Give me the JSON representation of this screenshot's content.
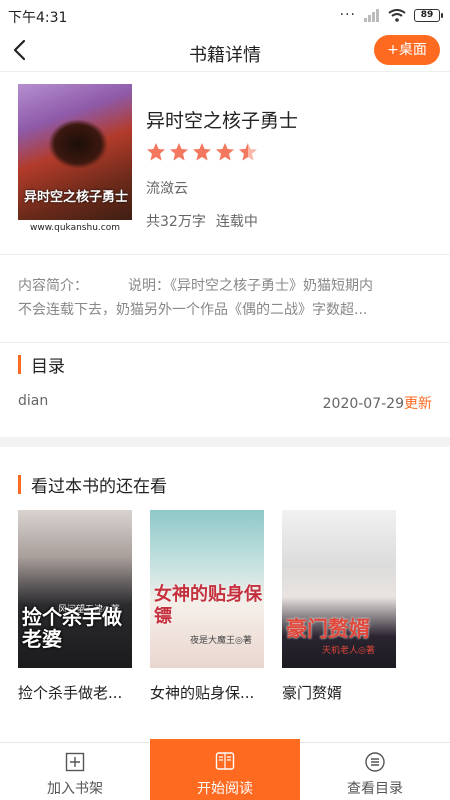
{
  "status": {
    "time": "下午4:31",
    "battery": "89"
  },
  "header": {
    "title": "书籍详情",
    "desk_button": "+桌面"
  },
  "book": {
    "title": "异时空之核子勇士",
    "rating": 4.5,
    "author": "流潋云",
    "word_count": "共32万字",
    "status": "连载中",
    "cover_title": "异时空之核子勇士",
    "cover_site": "www.qukanshu.com"
  },
  "intro": {
    "label": "内容简介：",
    "line1": "说明：《异时空之核子勇士》奶猫短期内",
    "line2": "不会连载下去，奶猫另外一个作品《偶的二战》字数超..."
  },
  "toc": {
    "heading": "目录",
    "latest_chapter": "dian",
    "date": "2020-07-29",
    "update_label": "更新"
  },
  "recommend": {
    "heading": "看过本书的还在看",
    "items": [
      {
        "name": "捡个杀手做老...",
        "cover_text": "捡个杀手做老婆",
        "cover_author": "风间望五津◎著"
      },
      {
        "name": "女神的贴身保...",
        "cover_text": "女神的贴身保镖",
        "cover_author": "夜是大魔王◎著"
      },
      {
        "name": "豪门赘婿",
        "cover_text": "豪门赘婿",
        "cover_author": "天机老人◎著"
      }
    ]
  },
  "bottom": {
    "add_shelf": "加入书架",
    "start_read": "开始阅读",
    "view_toc": "查看目录"
  },
  "colors": {
    "accent": "#ff6a21"
  }
}
